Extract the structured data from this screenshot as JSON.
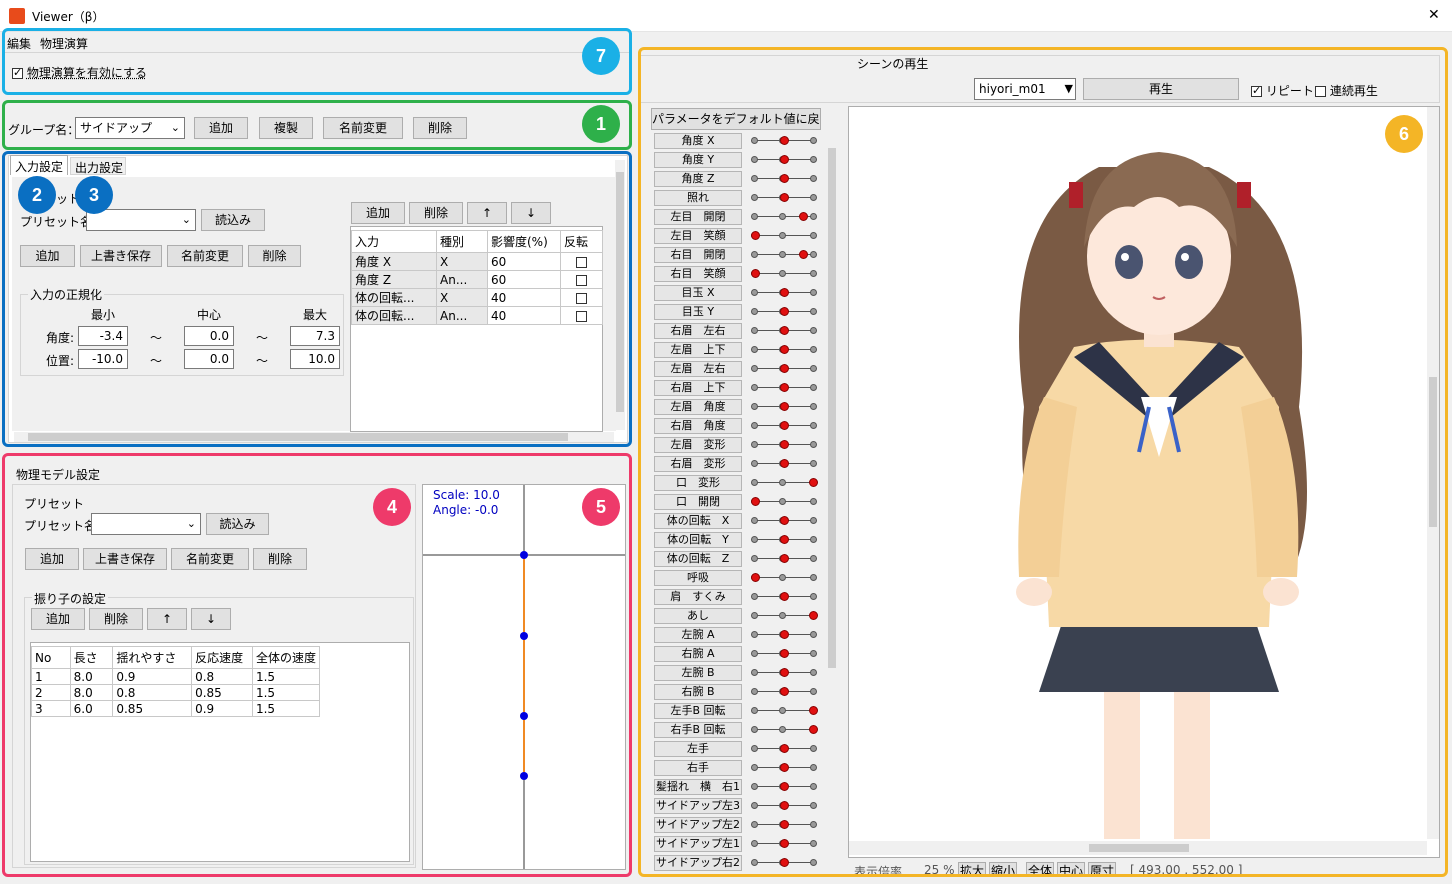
{
  "window": {
    "title": "Viewer（β）",
    "close_glyph": "✕"
  },
  "menu": {
    "edit": "編集",
    "physics": "物理演算"
  },
  "physics_enable": {
    "label": "物理演算を有効にする",
    "checked": true
  },
  "group": {
    "label": "グループ名：",
    "value": "サイドアップ",
    "add": "追加",
    "duplicate": "複製",
    "rename": "名前変更",
    "delete": "削除"
  },
  "tabs": {
    "input": "入力設定",
    "output": "出力設定"
  },
  "input_settings": {
    "preset_group": "プリセット",
    "preset_label": "プリセット名：",
    "preset_value": "",
    "load": "読込み",
    "add": "追加",
    "overwrite": "上書き保存",
    "rename": "名前変更",
    "delete": "削除",
    "normalize_title": "入力の正規化",
    "col_min": "最小",
    "col_center": "中心",
    "col_max": "最大",
    "angle_label": "角度:",
    "position_label": "位置:",
    "tilde": "〜",
    "angle": {
      "min": "-3.4",
      "center": "0.0",
      "max": "7.3"
    },
    "position": {
      "min": "-10.0",
      "center": "0.0",
      "max": "10.0"
    },
    "table_add": "追加",
    "table_delete": "削除",
    "up": "↑",
    "down": "↓",
    "table_headers": [
      "入力",
      "種別",
      "影響度(%)",
      "反転"
    ],
    "rows": [
      {
        "input": "角度 X",
        "type": "X",
        "influence": "60"
      },
      {
        "input": "角度 Z",
        "type": "An...",
        "influence": "60"
      },
      {
        "input": "体の回転...",
        "type": "X",
        "influence": "40"
      },
      {
        "input": "体の回転...",
        "type": "An...",
        "influence": "40"
      }
    ]
  },
  "physics_model": {
    "title": "物理モデル設定",
    "preset_group": "プリセット",
    "preset_label": "プリセット名：",
    "load": "読込み",
    "add": "追加",
    "overwrite": "上書き保存",
    "rename": "名前変更",
    "delete": "削除",
    "pendulum_title": "振り子の設定",
    "pend_add": "追加",
    "pend_delete": "削除",
    "up": "↑",
    "down": "↓",
    "headers": [
      "No",
      "長さ",
      "揺れやすさ",
      "反応速度",
      "全体の速度"
    ],
    "rows": [
      [
        "1",
        "8.0",
        "0.9",
        "0.8",
        "1.5"
      ],
      [
        "2",
        "8.0",
        "0.8",
        "0.85",
        "1.5"
      ],
      [
        "3",
        "6.0",
        "0.85",
        "0.9",
        "1.5"
      ]
    ]
  },
  "preview": {
    "scale_text": "Scale: 10.0",
    "angle_text": "Angle: -0.0"
  },
  "scene": {
    "title": "シーンの再生",
    "motion": "hiyori_m01",
    "play": "再生",
    "repeat_label": "リピート",
    "repeat_checked": true,
    "continuous_label": "連続再生",
    "continuous_checked": false
  },
  "params": {
    "reset_button": "パラメータをデフォルト値に戻す",
    "items": [
      {
        "label": "角度 X",
        "value": 0.5
      },
      {
        "label": "角度 Y",
        "value": 0.5
      },
      {
        "label": "角度 Z",
        "value": 0.5
      },
      {
        "label": "照れ",
        "value": 0.5
      },
      {
        "label": "左目　開閉",
        "value": 0.82
      },
      {
        "label": "左目　笑顔",
        "value": 0.0
      },
      {
        "label": "右目　開閉",
        "value": 0.82
      },
      {
        "label": "右目　笑顔",
        "value": 0.0
      },
      {
        "label": "目玉 X",
        "value": 0.5
      },
      {
        "label": "目玉 Y",
        "value": 0.5
      },
      {
        "label": "右眉　左右",
        "value": 0.5
      },
      {
        "label": "左眉　上下",
        "value": 0.5
      },
      {
        "label": "左眉　左右",
        "value": 0.5
      },
      {
        "label": "右眉　上下",
        "value": 0.5
      },
      {
        "label": "左眉　角度",
        "value": 0.5
      },
      {
        "label": "右眉　角度",
        "value": 0.5
      },
      {
        "label": "左眉　変形",
        "value": 0.5
      },
      {
        "label": "右眉　変形",
        "value": 0.5
      },
      {
        "label": "口　変形",
        "value": 1.0
      },
      {
        "label": "口　開閉",
        "value": 0.0
      },
      {
        "label": "体の回転　X",
        "value": 0.5
      },
      {
        "label": "体の回転　Y",
        "value": 0.5
      },
      {
        "label": "体の回転　Z",
        "value": 0.5
      },
      {
        "label": "呼吸",
        "value": 0.0
      },
      {
        "label": "肩　すくみ",
        "value": 0.5
      },
      {
        "label": "あし",
        "value": 1.0
      },
      {
        "label": "左腕 A",
        "value": 0.5
      },
      {
        "label": "右腕 A",
        "value": 0.5
      },
      {
        "label": "左腕 B",
        "value": 0.5
      },
      {
        "label": "右腕 B",
        "value": 0.5
      },
      {
        "label": "左手B 回転",
        "value": 1.0
      },
      {
        "label": "右手B 回転",
        "value": 1.0
      },
      {
        "label": "左手",
        "value": 0.5
      },
      {
        "label": "右手",
        "value": 0.5
      },
      {
        "label": "髪揺れ　横　右1",
        "value": 0.5
      },
      {
        "label": "サイドアップ左3",
        "value": 0.5
      },
      {
        "label": "サイドアップ左2",
        "value": 0.5
      },
      {
        "label": "サイドアップ左1",
        "value": 0.5
      },
      {
        "label": "サイドアップ右2",
        "value": 0.5
      }
    ]
  },
  "statusbar": {
    "zoom_label": "表示倍率",
    "zoom_value": "25 %",
    "zoom_in": "拡大",
    "zoom_out": "縮小",
    "fit": "全体",
    "center": "中心",
    "reset": "原寸",
    "coords": "[ 493.00 , 552.00 ]"
  },
  "annotations": {
    "n1": "1",
    "n2": "2",
    "n3": "3",
    "n4": "4",
    "n5": "5",
    "n6": "6",
    "n7": "7"
  },
  "colors": {
    "green": "#2eb04a",
    "blue": "#0a6fc2",
    "cyan": "#1ab0e6",
    "pink": "#ee3a6a",
    "orange": "#f4b526",
    "accent": "#e84b1b"
  }
}
